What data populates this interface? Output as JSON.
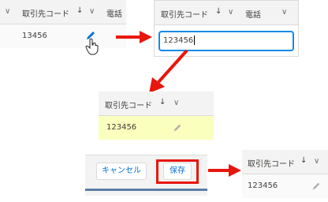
{
  "table": {
    "column_header": "取引先コード",
    "sort_icon": "down-arrow-icon",
    "menu_icon": "chevron-down-icon",
    "phone_header": "電話"
  },
  "step1": {
    "cell_value": "13456"
  },
  "step2": {
    "input_value": "123456"
  },
  "step3": {
    "cell_value": "123456"
  },
  "step4": {
    "cancel_label": "キャンセル",
    "save_label": "保存"
  },
  "step5": {
    "cell_value": "123456"
  },
  "colors": {
    "header_bg": "#f3f3f3",
    "edited_cell_bg": "#faffbd",
    "focus_border": "#1589ee",
    "annotation_red": "#e8160c",
    "brand_blue": "#0070d2"
  }
}
